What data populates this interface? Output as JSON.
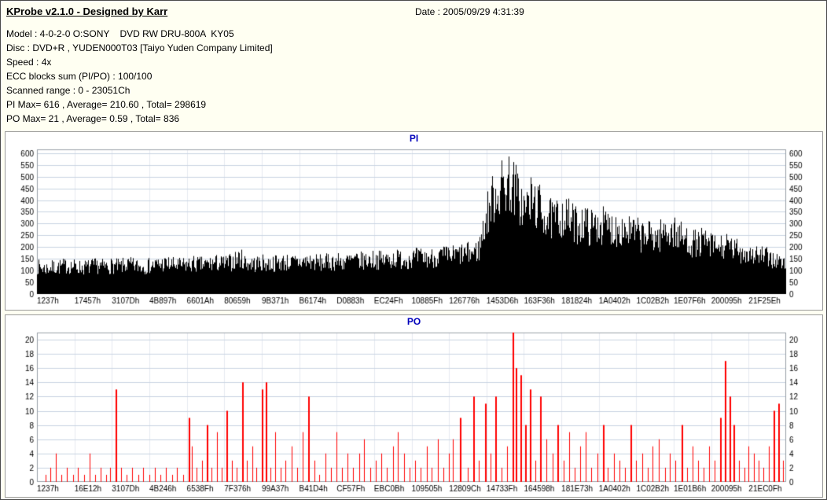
{
  "window": {
    "title": "KProbe v2.1.0 - Designed by Karr",
    "date_label": "Date : 2005/09/29 4:31:39"
  },
  "info": {
    "model": "Model : 4-0-2-0 O:SONY    DVD RW DRU-800A  KY05",
    "disc": "Disc : DVD+R , YUDEN000T03 [Taiyo Yuden Company Limited]",
    "speed": "Speed : 4x",
    "ecc": "ECC blocks sum (PI/PO) : 100/100",
    "range": "Scanned range : 0 - 23051Ch",
    "pi_stats": "PI Max= 616 , Average= 210.60 , Total= 298619",
    "po_stats": "PO Max= 21 , Average= 0.59 , Total= 836"
  },
  "chart_data": [
    {
      "id": "pi",
      "type": "bar",
      "title": "PI",
      "color": "#000000",
      "grid": true,
      "legend": "none",
      "xlabel": "",
      "ylabel": "",
      "ylim": [
        0,
        600
      ],
      "ytick": 50,
      "max": 616,
      "average": 210.6,
      "total": 298619,
      "xlabels": [
        "1237h",
        "17457h",
        "3107Dh",
        "4B897h",
        "6601Ah",
        "80659h",
        "9B371h",
        "B6174h",
        "D0883h",
        "EC24Fh",
        "10885Fh",
        "126776h",
        "1453D6h",
        "163F36h",
        "181824h",
        "1A0402h",
        "1C02B2h",
        "1E07F6h",
        "200095h",
        "21F25Eh"
      ],
      "envelope_note": "sampled upper-envelope of dense PI bar mass at 101 uniform x positions (fraction 0..1)",
      "envelope": [
        150,
        140,
        145,
        150,
        155,
        150,
        145,
        150,
        155,
        150,
        155,
        150,
        160,
        155,
        150,
        155,
        160,
        165,
        160,
        155,
        160,
        165,
        160,
        165,
        170,
        165,
        175,
        200,
        170,
        165,
        170,
        165,
        170,
        175,
        170,
        175,
        180,
        175,
        170,
        175,
        180,
        175,
        185,
        180,
        185,
        190,
        185,
        190,
        195,
        190,
        195,
        200,
        195,
        200,
        210,
        205,
        215,
        220,
        225,
        240,
        420,
        540,
        580,
        616,
        560,
        460,
        510,
        480,
        420,
        400,
        430,
        410,
        380,
        390,
        365,
        385,
        370,
        355,
        365,
        345,
        330,
        315,
        320,
        310,
        350,
        340,
        310,
        290,
        275,
        285,
        265,
        255,
        260,
        245,
        235,
        225,
        215,
        205,
        195,
        180,
        155
      ]
    },
    {
      "id": "po",
      "type": "bar",
      "title": "PO",
      "color": "#ff0000",
      "grid": true,
      "legend": "none",
      "xlabel": "",
      "ylabel": "",
      "ylim": [
        0,
        20
      ],
      "ytick": 2,
      "max": 21,
      "average": 0.59,
      "total": 836,
      "xlabels": [
        "1237h",
        "16E12h",
        "3107Dh",
        "4B246h",
        "6538Fh",
        "7F376h",
        "99A37h",
        "B41D4h",
        "CF57Fh",
        "EBC0Bh",
        "109505h",
        "12809Ch",
        "14733Fh",
        "164598h",
        "181E73h",
        "1A0402h",
        "1C02B2h",
        "1E01B6h",
        "200095h",
        "21EC0Fh"
      ],
      "spikes_note": "[x fraction 0..1, PO value] for each visible red spike (estimated)",
      "spikes": [
        [
          0.012,
          1
        ],
        [
          0.018,
          2
        ],
        [
          0.025,
          4
        ],
        [
          0.033,
          1
        ],
        [
          0.04,
          2
        ],
        [
          0.048,
          1
        ],
        [
          0.055,
          2
        ],
        [
          0.063,
          1
        ],
        [
          0.07,
          4
        ],
        [
          0.078,
          1
        ],
        [
          0.085,
          2
        ],
        [
          0.092,
          1
        ],
        [
          0.098,
          2
        ],
        [
          0.105,
          13
        ],
        [
          0.112,
          2
        ],
        [
          0.12,
          1
        ],
        [
          0.127,
          2
        ],
        [
          0.135,
          1
        ],
        [
          0.142,
          2
        ],
        [
          0.15,
          1
        ],
        [
          0.157,
          2
        ],
        [
          0.165,
          1
        ],
        [
          0.172,
          2
        ],
        [
          0.18,
          1
        ],
        [
          0.187,
          2
        ],
        [
          0.195,
          1
        ],
        [
          0.202,
          9
        ],
        [
          0.207,
          5
        ],
        [
          0.213,
          2
        ],
        [
          0.22,
          3
        ],
        [
          0.227,
          8
        ],
        [
          0.233,
          2
        ],
        [
          0.24,
          7
        ],
        [
          0.247,
          2
        ],
        [
          0.253,
          10
        ],
        [
          0.26,
          3
        ],
        [
          0.267,
          2
        ],
        [
          0.274,
          14
        ],
        [
          0.28,
          3
        ],
        [
          0.287,
          5
        ],
        [
          0.293,
          2
        ],
        [
          0.3,
          13
        ],
        [
          0.305,
          14
        ],
        [
          0.312,
          2
        ],
        [
          0.318,
          7
        ],
        [
          0.325,
          2
        ],
        [
          0.332,
          3
        ],
        [
          0.34,
          5
        ],
        [
          0.347,
          2
        ],
        [
          0.355,
          7
        ],
        [
          0.362,
          12
        ],
        [
          0.37,
          3
        ],
        [
          0.377,
          1
        ],
        [
          0.385,
          4
        ],
        [
          0.392,
          2
        ],
        [
          0.4,
          7
        ],
        [
          0.407,
          2
        ],
        [
          0.415,
          4
        ],
        [
          0.422,
          2
        ],
        [
          0.43,
          4
        ],
        [
          0.437,
          6
        ],
        [
          0.445,
          2
        ],
        [
          0.452,
          3
        ],
        [
          0.46,
          4
        ],
        [
          0.467,
          2
        ],
        [
          0.475,
          5
        ],
        [
          0.482,
          7
        ],
        [
          0.49,
          4
        ],
        [
          0.497,
          2
        ],
        [
          0.505,
          3
        ],
        [
          0.512,
          2
        ],
        [
          0.52,
          5
        ],
        [
          0.527,
          2
        ],
        [
          0.535,
          6
        ],
        [
          0.542,
          2
        ],
        [
          0.55,
          4
        ],
        [
          0.555,
          6
        ],
        [
          0.565,
          9
        ],
        [
          0.575,
          2
        ],
        [
          0.582,
          12
        ],
        [
          0.59,
          3
        ],
        [
          0.598,
          11
        ],
        [
          0.605,
          4
        ],
        [
          0.612,
          12
        ],
        [
          0.62,
          2
        ],
        [
          0.628,
          5
        ],
        [
          0.635,
          21
        ],
        [
          0.639,
          16
        ],
        [
          0.645,
          15
        ],
        [
          0.652,
          8
        ],
        [
          0.658,
          13
        ],
        [
          0.665,
          3
        ],
        [
          0.672,
          12
        ],
        [
          0.68,
          6
        ],
        [
          0.688,
          4
        ],
        [
          0.695,
          8
        ],
        [
          0.703,
          3
        ],
        [
          0.71,
          7
        ],
        [
          0.718,
          2
        ],
        [
          0.725,
          5
        ],
        [
          0.732,
          7
        ],
        [
          0.74,
          2
        ],
        [
          0.748,
          4
        ],
        [
          0.755,
          8
        ],
        [
          0.762,
          2
        ],
        [
          0.77,
          4
        ],
        [
          0.778,
          3
        ],
        [
          0.785,
          2
        ],
        [
          0.792,
          8
        ],
        [
          0.8,
          3
        ],
        [
          0.808,
          4
        ],
        [
          0.815,
          2
        ],
        [
          0.822,
          5
        ],
        [
          0.83,
          6
        ],
        [
          0.838,
          2
        ],
        [
          0.845,
          4
        ],
        [
          0.852,
          3
        ],
        [
          0.86,
          8
        ],
        [
          0.868,
          2
        ],
        [
          0.875,
          5
        ],
        [
          0.882,
          3
        ],
        [
          0.89,
          2
        ],
        [
          0.897,
          5
        ],
        [
          0.905,
          3
        ],
        [
          0.912,
          9
        ],
        [
          0.918,
          17
        ],
        [
          0.924,
          12
        ],
        [
          0.93,
          8
        ],
        [
          0.937,
          3
        ],
        [
          0.944,
          2
        ],
        [
          0.95,
          5
        ],
        [
          0.957,
          4
        ],
        [
          0.963,
          3
        ],
        [
          0.97,
          2
        ],
        [
          0.977,
          5
        ],
        [
          0.983,
          10
        ],
        [
          0.99,
          11
        ],
        [
          0.996,
          3
        ]
      ]
    }
  ]
}
